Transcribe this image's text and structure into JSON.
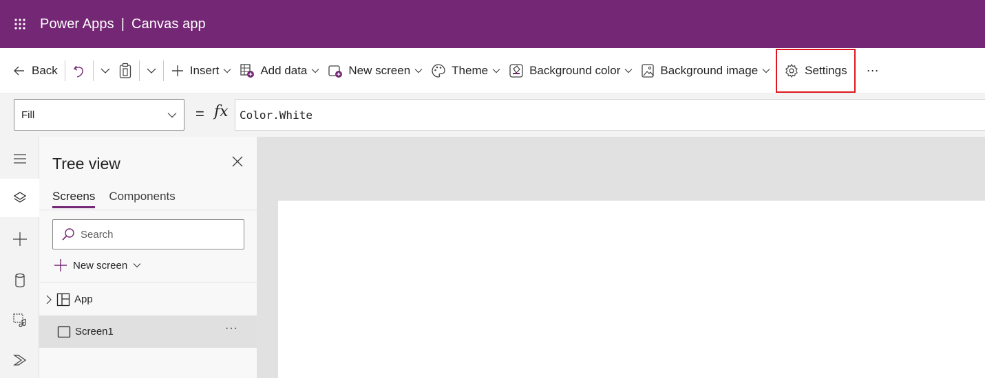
{
  "header": {
    "product": "Power Apps",
    "separator": "|",
    "app_type": "Canvas app",
    "background_color": "#742774"
  },
  "commandbar": {
    "back": "Back",
    "insert": "Insert",
    "add_data": "Add data",
    "new_screen": "New screen",
    "theme": "Theme",
    "background_color": "Background color",
    "background_image": "Background image",
    "settings": "Settings",
    "more": "···",
    "highlight_color": "#e0161e"
  },
  "formula_bar": {
    "property": "Fill",
    "equals": "=",
    "fx": "fx",
    "formula": "Color.White"
  },
  "rail": {
    "items": [
      "hamburger-icon",
      "layers-icon",
      "plus-icon",
      "database-icon",
      "media-icon",
      "power-automate-icon"
    ]
  },
  "tree_view": {
    "title": "Tree view",
    "tabs": [
      "Screens",
      "Components"
    ],
    "search_placeholder": "Search",
    "new_screen": "New screen",
    "items": [
      {
        "label": "App"
      },
      {
        "label": "Screen1",
        "more": "···"
      }
    ]
  }
}
